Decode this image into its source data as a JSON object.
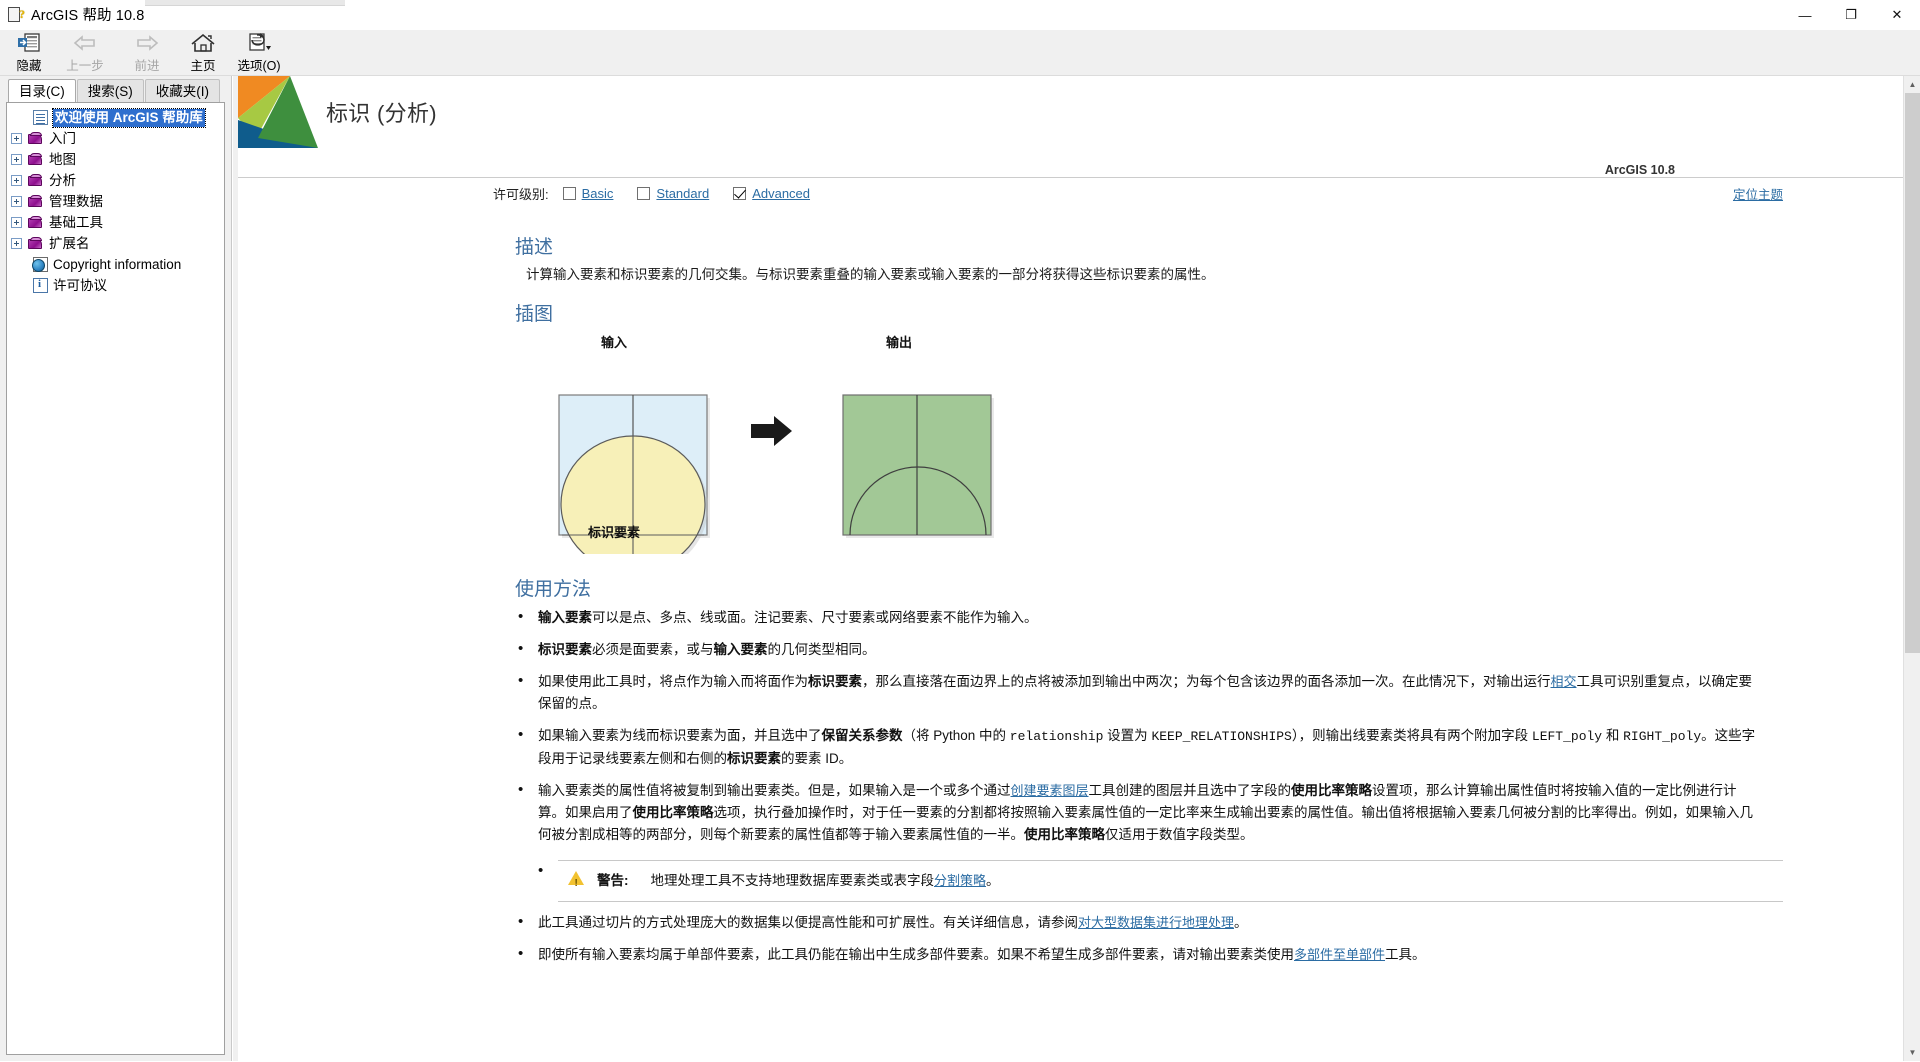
{
  "window": {
    "title": "ArcGIS 帮助 10.8",
    "app_icon": "help-document-icon",
    "minimize": "—",
    "maximize": "❐",
    "close": "✕"
  },
  "toolbar": {
    "buttons": [
      {
        "label": "隐藏",
        "icon": "hide-pane-icon",
        "enabled": true
      },
      {
        "label": "上一步",
        "icon": "back-arrow-icon",
        "enabled": false
      },
      {
        "label": "前进",
        "icon": "forward-arrow-icon",
        "enabled": false
      },
      {
        "label": "主页",
        "icon": "home-icon",
        "enabled": true
      },
      {
        "label": "选项(O)",
        "icon": "options-icon",
        "enabled": true
      }
    ]
  },
  "sidebar": {
    "tabs": [
      {
        "label": "目录(C)",
        "active": true
      },
      {
        "label": "搜索(S)",
        "active": false
      },
      {
        "label": "收藏夹(I)",
        "active": false
      }
    ],
    "tree": [
      {
        "label": "欢迎使用 ArcGIS 帮助库",
        "icon": "page-icon",
        "expandable": false,
        "selected": true
      },
      {
        "label": "入门",
        "icon": "book-icon",
        "expandable": true,
        "selected": false
      },
      {
        "label": "地图",
        "icon": "book-icon",
        "expandable": true,
        "selected": false
      },
      {
        "label": "分析",
        "icon": "book-icon",
        "expandable": true,
        "selected": false
      },
      {
        "label": "管理数据",
        "icon": "book-icon",
        "expandable": true,
        "selected": false
      },
      {
        "label": "基础工具",
        "icon": "book-icon",
        "expandable": true,
        "selected": false
      },
      {
        "label": "扩展名",
        "icon": "book-icon",
        "expandable": true,
        "selected": false
      },
      {
        "label": "Copyright information",
        "icon": "globe-icon",
        "expandable": false,
        "selected": false
      },
      {
        "label": "许可协议",
        "icon": "info-icon",
        "expandable": false,
        "selected": false
      }
    ]
  },
  "page": {
    "title": "标识 (分析)",
    "version": "ArcGIS 10.8",
    "locate_topic": "定位主题",
    "license": {
      "label": "许可级别:",
      "levels": [
        {
          "name": "Basic",
          "checked": false
        },
        {
          "name": "Standard",
          "checked": false
        },
        {
          "name": "Advanced",
          "checked": true
        }
      ]
    },
    "description": {
      "heading": "描述",
      "text": "计算输入要素和标识要素的几何交集。与标识要素重叠的输入要素或输入要素的一部分将获得这些标识要素的属性。"
    },
    "illustration": {
      "heading": "插图",
      "input_caption": "输入",
      "output_caption": "输出",
      "identity_caption": "标识要素",
      "input_polygon_color": "#ddeef8",
      "identity_circle_color": "#f7f0b8",
      "output_polygon_color": "#a2c896",
      "arrow": "➡"
    },
    "usage": {
      "heading": "使用方法",
      "items": [
        {
          "parts": [
            {
              "t": "输入要素",
              "s": "b"
            },
            {
              "t": "可以是点、多点、线或面。注记要素、尺寸要素或网络要素不能作为输入。",
              "s": "n"
            }
          ]
        },
        {
          "parts": [
            {
              "t": "标识要素",
              "s": "b"
            },
            {
              "t": "必须是面要素，或与",
              "s": "n"
            },
            {
              "t": "输入要素",
              "s": "b"
            },
            {
              "t": "的几何类型相同。",
              "s": "n"
            }
          ]
        },
        {
          "parts": [
            {
              "t": "如果使用此工具时，将点作为输入而将面作为",
              "s": "n"
            },
            {
              "t": "标识要素",
              "s": "b"
            },
            {
              "t": "，那么直接落在面边界上的点将被添加到输出中两次；为每个包含该边界的面各添加一次。在此情况下，对输出运行",
              "s": "n"
            },
            {
              "t": "相交",
              "s": "a"
            },
            {
              "t": "工具可识别重复点，以确定要保留的点。",
              "s": "n"
            }
          ]
        },
        {
          "parts": [
            {
              "t": "如果输入要素为线而标识要素为面，并且选中了",
              "s": "n"
            },
            {
              "t": "保留关系参数",
              "s": "b"
            },
            {
              "t": "（将 Python 中的 ",
              "s": "n"
            },
            {
              "t": "relationship",
              "s": "c"
            },
            {
              "t": " 设置为 ",
              "s": "n"
            },
            {
              "t": "KEEP_RELATIONSHIPS",
              "s": "c"
            },
            {
              "t": "），则输出线要素类将具有两个附加字段 ",
              "s": "n"
            },
            {
              "t": "LEFT_poly",
              "s": "c"
            },
            {
              "t": " 和 ",
              "s": "n"
            },
            {
              "t": "RIGHT_poly",
              "s": "c"
            },
            {
              "t": "。这些字段用于记录线要素左侧和右侧的",
              "s": "n"
            },
            {
              "t": "标识要素",
              "s": "b"
            },
            {
              "t": "的要素 ID。",
              "s": "n"
            }
          ]
        },
        {
          "parts": [
            {
              "t": "输入要素类的属性值将被复制到输出要素类。但是，如果输入是一个或多个通过",
              "s": "n"
            },
            {
              "t": "创建要素图层",
              "s": "a"
            },
            {
              "t": "工具创建的图层并且选中了字段的",
              "s": "n"
            },
            {
              "t": "使用比率策略",
              "s": "b"
            },
            {
              "t": "设置项，那么计算输出属性值时将按输入值的一定比例进行计算。如果启用了",
              "s": "n"
            },
            {
              "t": "使用比率策略",
              "s": "b"
            },
            {
              "t": "选项，执行叠加操作时，对于任一要素的分割都将按照输入要素属性值的一定比率来生成输出要素的属性值。输出值将根据输入要素几何被分割的比率得出。例如，如果输入几何被分割成相等的两部分，则每个新要素的属性值都等于输入要素属性值的一半。",
              "s": "n"
            },
            {
              "t": "使用比率策略",
              "s": "b"
            },
            {
              "t": "仅适用于数值字段类型。",
              "s": "n"
            }
          ]
        }
      ],
      "warning": {
        "icon": "warning-triangle-icon",
        "label": "警告:",
        "parts": [
          {
            "t": "地理处理工具不支持地理数据库要素类或表字段",
            "s": "n"
          },
          {
            "t": "分割策略",
            "s": "a"
          },
          {
            "t": "。",
            "s": "n"
          }
        ]
      },
      "items_after": [
        {
          "parts": [
            {
              "t": "此工具通过切片的方式处理庞大的数据集以便提高性能和可扩展性。有关详细信息，请参阅",
              "s": "n"
            },
            {
              "t": "对大型数据集进行地理处理",
              "s": "a"
            },
            {
              "t": "。",
              "s": "n"
            }
          ]
        },
        {
          "parts": [
            {
              "t": "即使所有输入要素均属于单部件要素，此工具仍能在输出中生成多部件要素。如果不希望生成多部件要素，请对输出要素类使用",
              "s": "n"
            },
            {
              "t": "多部件至单部件",
              "s": "a"
            },
            {
              "t": "工具。",
              "s": "n"
            }
          ]
        }
      ]
    }
  },
  "colors": {
    "link": "#2b6ca3",
    "heading": "#3f6fa0",
    "banner_orange": "#f08a22",
    "banner_green": "#3e8f3e",
    "banner_lightgreen": "#a7c943",
    "banner_blue": "#0f5c8c",
    "selection_blue": "#2f6fce"
  }
}
